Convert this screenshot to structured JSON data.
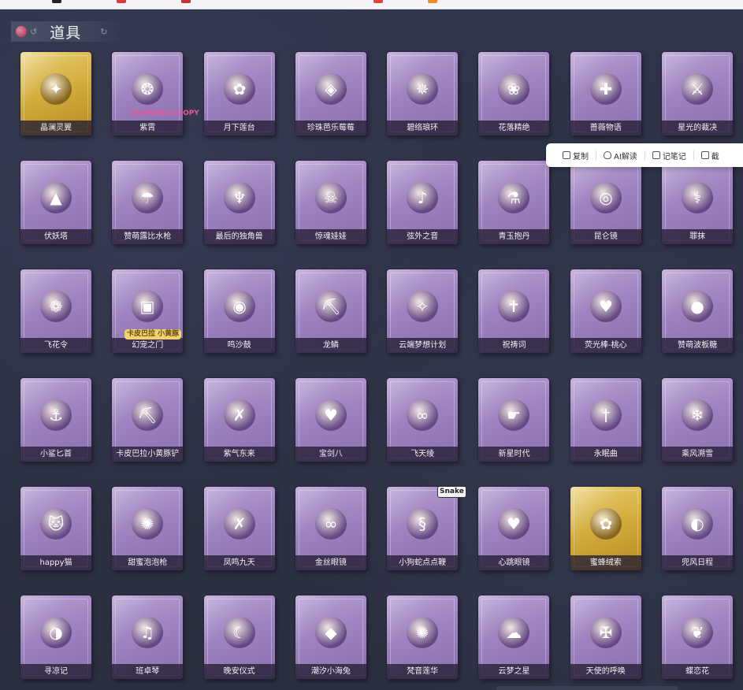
{
  "section": {
    "title": "道具"
  },
  "toolbar": {
    "copy": "复制",
    "ai": "AI解读",
    "note": "记笔记",
    "more": "截"
  },
  "badges": {
    "loopy": "ZANMANG LOOPY",
    "kapi": "卡皮巴拉 小黄豚",
    "snake": "Snake"
  },
  "items": [
    {
      "label": "晶澜灵翼",
      "icon": "butterfly-wings-icon",
      "gold": true
    },
    {
      "label": "紫霄",
      "icon": "amulet-necklace-icon"
    },
    {
      "label": "月下莲台",
      "icon": "lotus-lantern-icon"
    },
    {
      "label": "珍珠芭乐莓莓",
      "icon": "bubble-tea-icon"
    },
    {
      "label": "碧络琅环",
      "icon": "jade-pendant-icon"
    },
    {
      "label": "花落精绝",
      "icon": "flower-necklace-icon"
    },
    {
      "label": "蔷薇物语",
      "icon": "first-aid-kit-icon"
    },
    {
      "label": "星光的裁决",
      "icon": "flintlock-gun-icon"
    },
    {
      "label": "伏妖塔",
      "icon": "golden-pagoda-icon"
    },
    {
      "label": "赞萌露比水枪",
      "icon": "water-gun-icon"
    },
    {
      "label": "最后的独角兽",
      "icon": "unicorn-sword-icon"
    },
    {
      "label": "惊魂娃娃",
      "icon": "skull-doll-icon"
    },
    {
      "label": "弦外之音",
      "icon": "lute-pendant-icon"
    },
    {
      "label": "青玉抱丹",
      "icon": "potion-bottle-icon"
    },
    {
      "label": "昆仑镜",
      "icon": "ornate-mirror-icon"
    },
    {
      "label": "罪抹",
      "icon": "spear-icon"
    },
    {
      "label": "飞花令",
      "icon": "flower-lantern-icon"
    },
    {
      "label": "幻宠之门",
      "icon": "tamagotchi-icon"
    },
    {
      "label": "鸣沙鼓",
      "icon": "dreamcatcher-icon"
    },
    {
      "label": "龙鳞",
      "icon": "golden-shovel-icon"
    },
    {
      "label": "云端梦想计划",
      "icon": "magic-wand-icon"
    },
    {
      "label": "祝祷词",
      "icon": "cross-rosary-icon"
    },
    {
      "label": "荧光棒-桃心",
      "icon": "heart-wand-icon"
    },
    {
      "label": "赞萌波板糖",
      "icon": "lollipop-icon"
    },
    {
      "label": "小鲨匕首",
      "icon": "shark-dagger-icon"
    },
    {
      "label": "卡皮巴拉小黄豚铲",
      "icon": "capybara-shovel-icon"
    },
    {
      "label": "紫气东来",
      "icon": "purple-sword-icon"
    },
    {
      "label": "宝剑八",
      "icon": "heart-shield-icon"
    },
    {
      "label": "飞天绫",
      "icon": "ribbon-ring-icon"
    },
    {
      "label": "新星时代",
      "icon": "revolver-icon"
    },
    {
      "label": "永眠曲",
      "icon": "violet-blade-icon"
    },
    {
      "label": "乘风溯雪",
      "icon": "ice-cannon-icon"
    },
    {
      "label": "happy猫",
      "icon": "happy-cat-icon"
    },
    {
      "label": "甜蜜泡泡枪",
      "icon": "bubble-gun-icon"
    },
    {
      "label": "凤鸣九天",
      "icon": "red-sword-icon"
    },
    {
      "label": "金丝眼镜",
      "icon": "glasses-icon"
    },
    {
      "label": "小狗蛇点点鞭",
      "icon": "snake-whip-icon"
    },
    {
      "label": "心跳眼镜",
      "icon": "heart-glasses-icon"
    },
    {
      "label": "蜜蜂绒索",
      "icon": "bee-loopy-icon",
      "gold": true
    },
    {
      "label": "兜风日程",
      "icon": "loopy-cap-icon"
    },
    {
      "label": "寻凉记",
      "icon": "loopy-hat-icon"
    },
    {
      "label": "班卓琴",
      "icon": "loopy-banjo-icon"
    },
    {
      "label": "晚安仪式",
      "icon": "loopy-book-icon"
    },
    {
      "label": "潮汐小海兔",
      "icon": "blue-cat-icon"
    },
    {
      "label": "梵音莲华",
      "icon": "doll-girl-icon"
    },
    {
      "label": "云梦之星",
      "icon": "unicorn-cloud-icon"
    },
    {
      "label": "天使的呼唤",
      "icon": "angel-doll-icon"
    },
    {
      "label": "蝶恋花",
      "icon": "butterfly-vase-icon"
    }
  ]
}
